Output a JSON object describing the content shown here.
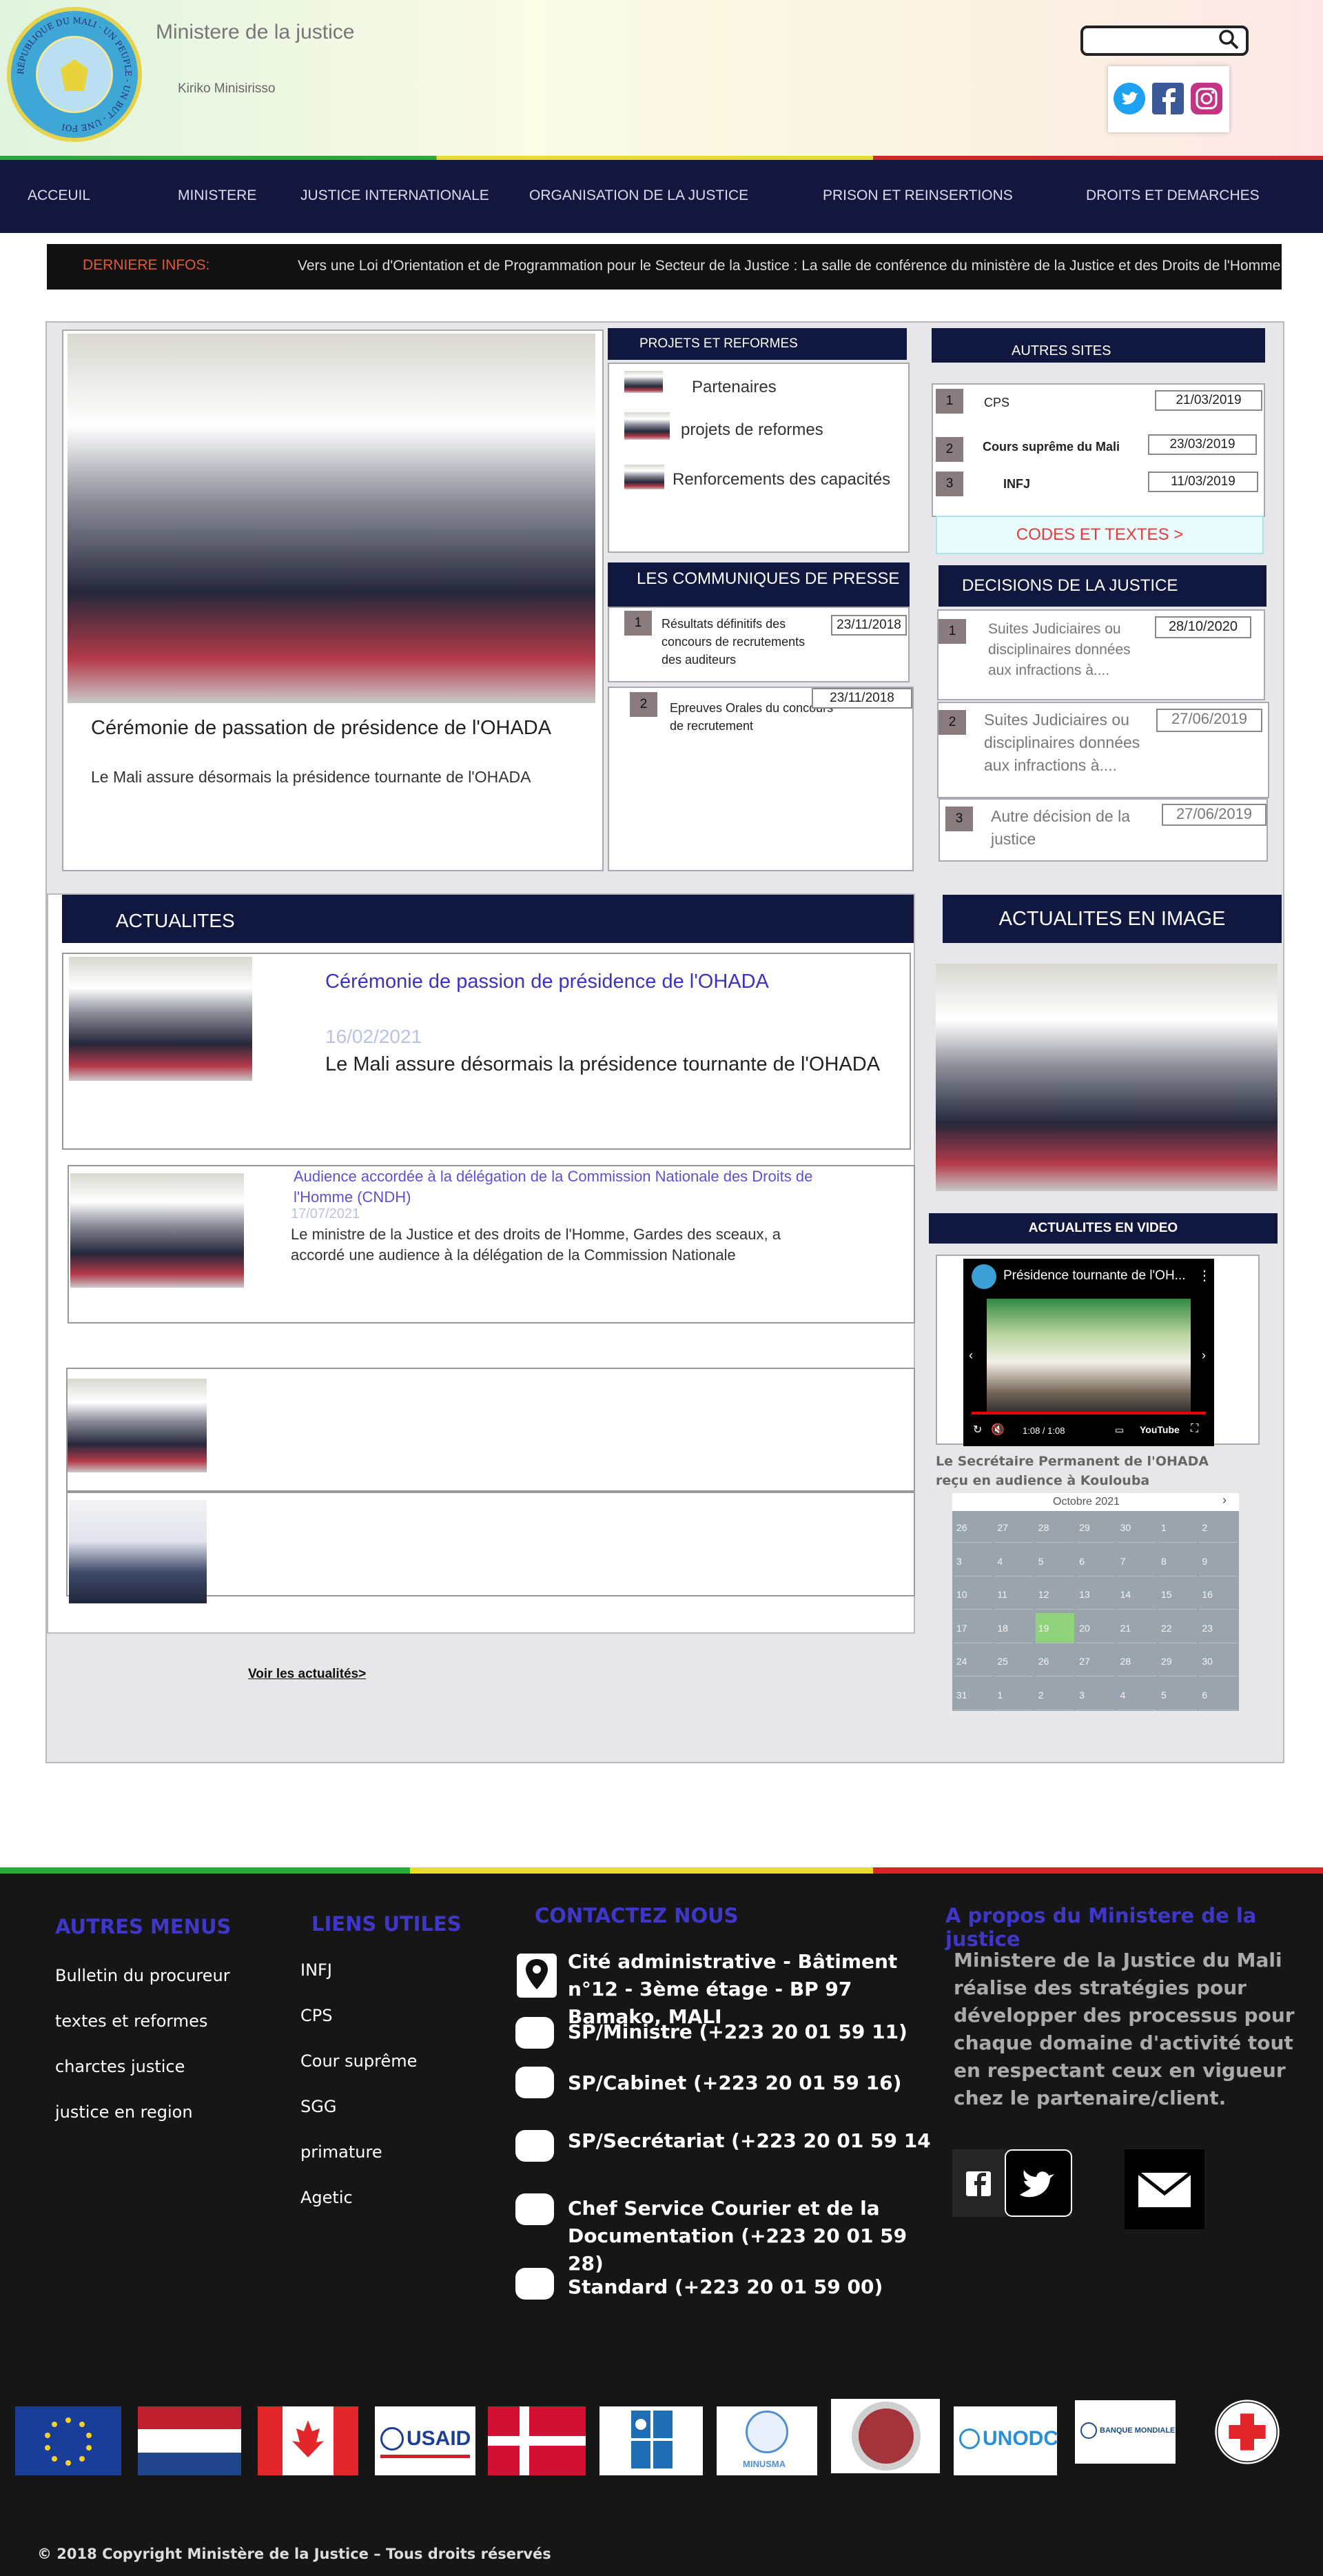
{
  "header": {
    "title": "Ministere de la justice",
    "subtitle": "Kiriko Minisirisso",
    "logo_text": "RÉPUBLIQUE DU MALI · UN PEUPLE - UN BUT - UNE FOI",
    "search_placeholder": ""
  },
  "nav": {
    "items": [
      "ACCEUIL",
      "MINISTERE",
      "JUSTICE INTERNATIONALE",
      "ORGANISATION DE LA JUSTICE",
      "PRISON ET REINSERTIONS",
      "DROITS ET DEMARCHES"
    ]
  },
  "ticker": {
    "label": "DERNIERE INFOS:",
    "text": "Vers une Loi d'Orientation et de Programmation pour le Secteur de la Justice : La salle de conférence du ministère de la Justice et des Droits de l'Homme"
  },
  "feature": {
    "title": "Cérémonie de passation de présidence de l'OHADA",
    "text": "Le Mali assure désormais la présidence tournante de l'OHADA"
  },
  "projets": {
    "header": "PROJETS ET REFORMES",
    "items": [
      "Partenaires",
      "projets de reformes",
      "Renforcements des capacités"
    ]
  },
  "communiques": {
    "header": "LES COMMUNIQUES DE PRESSE",
    "items": [
      {
        "num": "1",
        "text": "Résultats définitifs des concours de recrutements des auditeurs",
        "date": "23/11/2018"
      },
      {
        "num": "2",
        "text": "Epreuves Orales du concours de recrutement",
        "date": "23/11/2018"
      }
    ]
  },
  "autres_sites": {
    "header": "AUTRES SITES",
    "items": [
      {
        "num": "1",
        "name": "CPS",
        "date": "21/03/2019"
      },
      {
        "num": "2",
        "name": "Cours suprême du Mali",
        "date": "23/03/2019"
      },
      {
        "num": "3",
        "name": "INFJ",
        "date": "11/03/2019"
      }
    ],
    "codes_button": "CODES ET TEXTES >"
  },
  "decisions": {
    "header": "DECISIONS DE LA JUSTICE",
    "items": [
      {
        "num": "1",
        "text": "Suites Judiciaires ou disciplinaires données aux infractions à....",
        "date": "28/10/2020"
      },
      {
        "num": "2",
        "text": "Suites Judiciaires ou disciplinaires données aux infractions à....",
        "date": "27/06/2019"
      },
      {
        "num": "3",
        "text": "Autre décision de la justice",
        "date": "27/06/2019"
      }
    ]
  },
  "actualites": {
    "header": "ACTUALITES",
    "items": [
      {
        "title": "Cérémonie de passion de présidence de l'OHADA",
        "date": "16/02/2021",
        "text": "Le Mali assure désormais la présidence tournante de l'OHADA"
      },
      {
        "title": "Audience accordée à la délégation de la Commission Nationale des Droits de l'Homme (CNDH)",
        "date": "17/07/2021",
        "text": "Le ministre de la Justice et des droits de l'Homme, Gardes des sceaux, a accordé une audience à la délégation de la Commission Nationale"
      }
    ],
    "more_link": "Voir les actualités>"
  },
  "actualites_image": {
    "header": "ACTUALITES EN IMAGE"
  },
  "actualites_video": {
    "header": "ACTUALITES EN VIDEO",
    "video_title": "Présidence tournante de l'OH...",
    "time": "1:08 / 1:08",
    "youtube": "YouTube",
    "caption": "Le Secrétaire Permanent de l'OHADA reçu en audience à Koulouba"
  },
  "calendar": {
    "month": "Octobre 2021",
    "next": "›",
    "rows": [
      [
        "26",
        "27",
        "28",
        "29",
        "30",
        "1",
        "2"
      ],
      [
        "3",
        "4",
        "5",
        "6",
        "7",
        "8",
        "9"
      ],
      [
        "10",
        "11",
        "12",
        "13",
        "14",
        "15",
        "16"
      ],
      [
        "17",
        "18",
        "19",
        "20",
        "21",
        "22",
        "23"
      ],
      [
        "24",
        "25",
        "26",
        "27",
        "28",
        "29",
        "30"
      ],
      [
        "31",
        "1",
        "2",
        "3",
        "4",
        "5",
        "6"
      ]
    ],
    "today": "19"
  },
  "footer": {
    "autres_menus": {
      "header": "AUTRES MENUS",
      "items": [
        "Bulletin du procureur",
        "textes et reformes",
        "charctes justice",
        "justice en region"
      ]
    },
    "liens_utiles": {
      "header": "LIENS UTILES",
      "items": [
        "INFJ",
        "CPS",
        "Cour suprême",
        "SGG",
        "primature",
        "Agetic"
      ]
    },
    "contact": {
      "header": "CONTACTEZ NOUS",
      "address": "Cité administrative - Bâtiment n°12 - 3ème étage - BP 97 Bamako, MALI",
      "lines": [
        "SP/Ministre (+223 20 01 59 11)",
        "SP/Cabinet (+223 20 01 59 16)",
        "SP/Secrétariat (+223 20 01 59 14",
        "Chef Service Courier et de la Documentation (+223 20 01 59 28)",
        "Standard (+223 20 01 59 00)"
      ]
    },
    "about": {
      "header": "A propos du Ministere de la justice",
      "text": "Ministere de la Justice du Mali réalise des stratégies pour développer des processus pour chaque domaine d'activité tout en respectant ceux en vigueur chez le partenaire/client."
    },
    "partners": [
      "USAID",
      "UNODC",
      "BANQUE MONDIALE",
      "MINUSMA"
    ],
    "copyright": "© 2018 Copyright Ministère de la Justice – Tous droits réservés"
  }
}
